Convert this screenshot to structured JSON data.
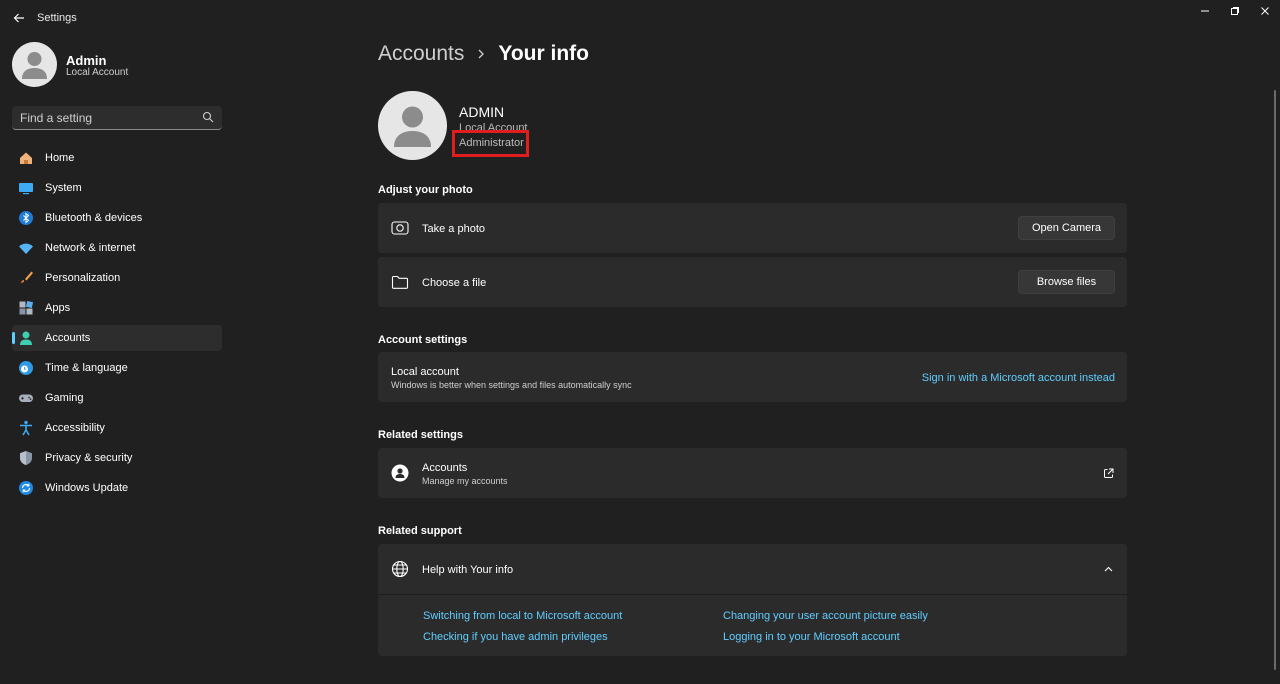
{
  "window": {
    "title": "Settings"
  },
  "profile": {
    "name": "Admin",
    "account_type": "Local Account"
  },
  "search": {
    "placeholder": "Find a setting"
  },
  "sidebar": {
    "items": [
      {
        "label": "Home"
      },
      {
        "label": "System"
      },
      {
        "label": "Bluetooth & devices"
      },
      {
        "label": "Network & internet"
      },
      {
        "label": "Personalization"
      },
      {
        "label": "Apps"
      },
      {
        "label": "Accounts"
      },
      {
        "label": "Time & language"
      },
      {
        "label": "Gaming"
      },
      {
        "label": "Accessibility"
      },
      {
        "label": "Privacy & security"
      },
      {
        "label": "Windows Update"
      }
    ],
    "active": "Accounts"
  },
  "breadcrumb": {
    "parent": "Accounts",
    "current": "Your info"
  },
  "user": {
    "name": "ADMIN",
    "account_type": "Local Account",
    "role": "Administrator"
  },
  "photo": {
    "section_title": "Adjust your photo",
    "take_photo": {
      "label": "Take a photo",
      "button": "Open Camera"
    },
    "choose_file": {
      "label": "Choose a file",
      "button": "Browse files"
    }
  },
  "account_settings": {
    "section_title": "Account settings",
    "label": "Local account",
    "description": "Windows is better when settings and files automatically sync",
    "link": "Sign in with a Microsoft account instead"
  },
  "related_settings": {
    "section_title": "Related settings",
    "label": "Accounts",
    "description": "Manage my accounts"
  },
  "related_support": {
    "section_title": "Related support",
    "label": "Help with Your info",
    "links": [
      "Switching from local to Microsoft account",
      "Changing your user account picture easily",
      "Checking if you have admin privileges",
      "Logging in to your Microsoft account"
    ]
  },
  "colors": {
    "accent": "#60cdff",
    "highlight": "#e01e1e",
    "background": "#202020",
    "card": "#2b2b2b"
  }
}
